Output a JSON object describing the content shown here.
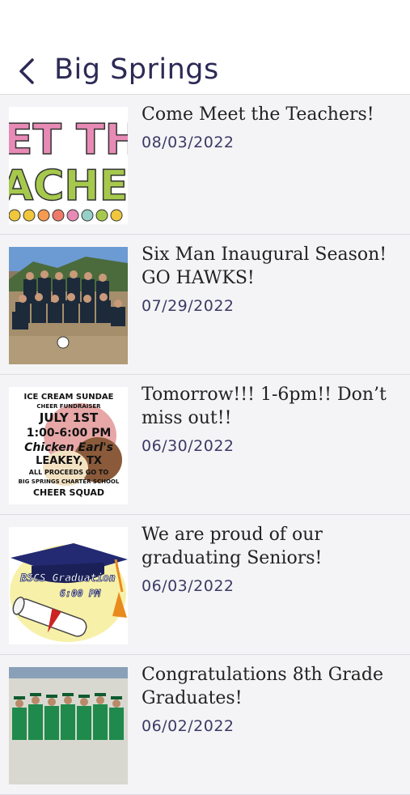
{
  "header": {
    "title": "Big Springs"
  },
  "posts": [
    {
      "title": "Come Meet the Teachers!",
      "date": "08/03/2022"
    },
    {
      "title": "Six Man Inaugural Season! GO HAWKS!",
      "date": "07/29/2022"
    },
    {
      "title": "Tomorrow!!! 1-6pm!!  Don’t miss out!!",
      "date": "06/30/2022"
    },
    {
      "title": "We are proud of our graduating Seniors!",
      "date": "06/03/2022"
    },
    {
      "title": "Congratulations 8th Grade Graduates!",
      "date": "06/02/2022"
    }
  ],
  "thumb_text": {
    "meet_line1": "ET TH",
    "meet_line2": "ACHE",
    "ice_l1": "ICE CREAM SUNDAE",
    "ice_l2": "CHEER FUNDRAISER",
    "ice_l3": "JULY 1ST",
    "ice_l4": "1:00-6:00 PM",
    "ice_l5": "Chicken Earl's",
    "ice_l6": "LEAKEY, TX",
    "ice_l7": "ALL PROCEEDS GO TO",
    "ice_l8": "BIG SPRINGS CHARTER SCHOOL",
    "ice_l9": "CHEER SQUAD",
    "grad_l1": "BSCS Graduation",
    "grad_l2": "6:00 PM"
  }
}
